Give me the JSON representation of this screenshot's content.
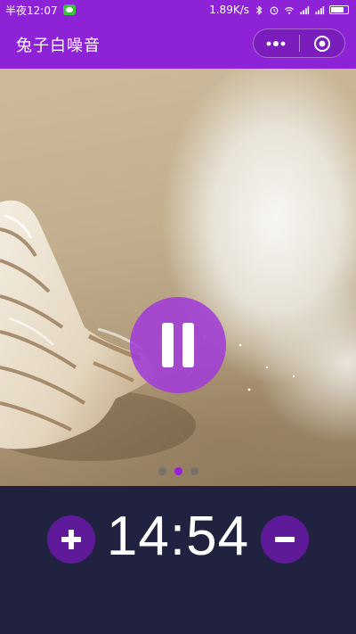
{
  "status_bar": {
    "time": "半夜12:07",
    "network_speed": "1.89K/s",
    "icons": [
      "wechat-icon",
      "bluetooth-icon",
      "alarm-icon",
      "wifi-icon",
      "signal-icon",
      "signal-icon",
      "battery-icon"
    ]
  },
  "app": {
    "title": "兔子白噪音",
    "menu_icon": "more-dots-icon",
    "close_icon": "target-circle-icon"
  },
  "player": {
    "state": "playing",
    "button_icon": "pause-icon",
    "slide_count": 3,
    "active_slide": 2
  },
  "timer": {
    "value": "14:54",
    "increase_icon": "plus-icon",
    "decrease_icon": "minus-icon"
  },
  "colors": {
    "header": "#8d22d6",
    "accent": "#9a1ee0",
    "panel": "#21223f",
    "timer_buttons": "#5e1a99"
  }
}
